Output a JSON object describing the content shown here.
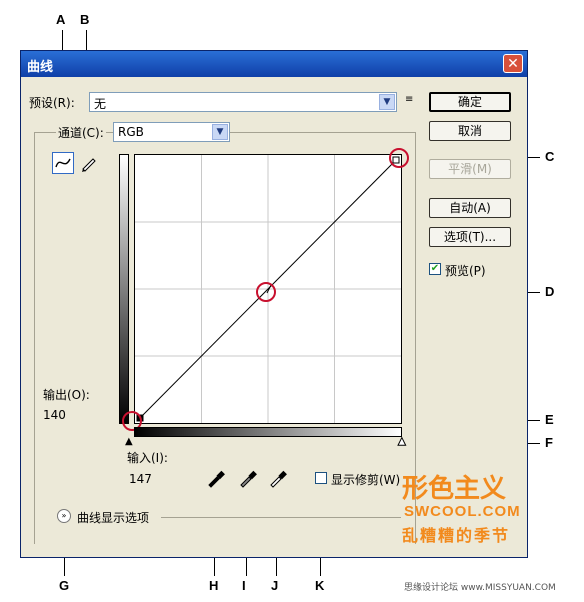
{
  "callouts": {
    "A": "A",
    "B": "B",
    "C": "C",
    "D": "D",
    "E": "E",
    "F": "F",
    "G": "G",
    "H": "H",
    "I": "I",
    "J": "J",
    "K": "K"
  },
  "dialog": {
    "title": "曲线",
    "close_glyph": "✕",
    "preset_label": "预设(R):",
    "preset_value": "无",
    "channel_label": "通道(C):",
    "channel_value": "RGB",
    "output_label": "输出(O):",
    "output_value": "140",
    "input_label": "输入(I):",
    "input_value": "147",
    "show_clipping_label": "显示修剪(W)",
    "curve_display_options": "曲线显示选项",
    "preview_label": "预览(P)",
    "preview_checked": true,
    "buttons": {
      "ok": "确定",
      "cancel": "取消",
      "smooth": "平滑(M)",
      "auto": "自动(A)",
      "options": "选项(T)..."
    },
    "icons": {
      "curve_tool": "curve-point-tool-icon",
      "pencil_tool": "pencil-tool-icon",
      "black_eyedropper": "black-point-eyedropper-icon",
      "gray_eyedropper": "gray-point-eyedropper-icon",
      "white_eyedropper": "white-point-eyedropper-icon",
      "preset_menu": "preset-options-icon",
      "expand": "chevron-double-down-icon"
    },
    "accent_red": "#c8102e"
  },
  "watermark": {
    "logo_text": "形色主义",
    "site": "SWCOOL.COM",
    "tagline": "乱糟糟的季节",
    "footer": "思缘设计论坛 www.MISSYUAN.COM"
  }
}
